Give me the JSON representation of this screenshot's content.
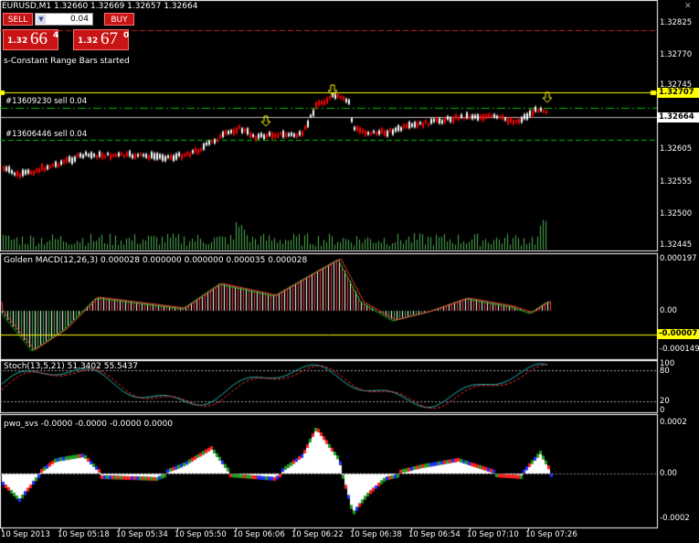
{
  "window": {
    "symbol_header": "EURUSD,M1  1.32660 1.32669 1.32657 1.32664",
    "close_icon": "close-icon"
  },
  "trade_panel": {
    "sell_label": "SELL",
    "buy_label": "BUY",
    "lot_value": "0.04",
    "sell_price_small": "1.32",
    "sell_price_big": "66",
    "sell_price_sup": "4",
    "buy_price_small": "1.32",
    "buy_price_big": "67",
    "buy_price_sup": "0"
  },
  "status_text": "s-Constant Range Bars started",
  "orders": [
    {
      "label": "#13609230 sell 0.04"
    },
    {
      "label": "#13606446 sell 0.04"
    }
  ],
  "main_axis": [
    "1.32825",
    "1.32770",
    "1.32745",
    "1.32664",
    "1.32605",
    "1.32555",
    "1.32500",
    "1.32445"
  ],
  "price_boxes": {
    "level": "1.32707",
    "level_color": "#ffff00",
    "current": "1.32664",
    "current_color": "#ffffff"
  },
  "macd": {
    "label": "Golden MACD(12,26,3) 0.000028 0.000000 0.000000 0.000035 0.000028",
    "axis": [
      "0.000197",
      "0.00",
      "-0.000149"
    ],
    "box_value": "-0.00007",
    "box_color": "#ffff00"
  },
  "stoch": {
    "label": "Stoch(13,5,21) 51.3402 55.5437",
    "axis": [
      "100",
      "80",
      "20",
      "0"
    ]
  },
  "pwo": {
    "label": "pwo_svs -0.0000 -0.0000 -0.0000 0.0000",
    "axis": [
      "0.0002",
      "0.00",
      "-0.0002"
    ]
  },
  "time_axis": [
    "10 Sep 2013",
    "10 Sep 05:18",
    "10 Sep 05:34",
    "10 Sep 05:50",
    "10 Sep 06:06",
    "10 Sep 06:22",
    "10 Sep 06:38",
    "10 Sep 06:54",
    "10 Sep 07:10",
    "10 Sep 07:26"
  ],
  "colors": {
    "bull": "#ffffff",
    "bear": "#ff0000",
    "grid": "#ffffff",
    "order_line": "#00c000",
    "level_line": "#ffff00",
    "volume": "#4caf50",
    "macd_fast": "#ff4040",
    "macd_slow": "#20c020",
    "stoch_main": "#20b0b0",
    "stoch_signal": "#ff3030"
  }
}
